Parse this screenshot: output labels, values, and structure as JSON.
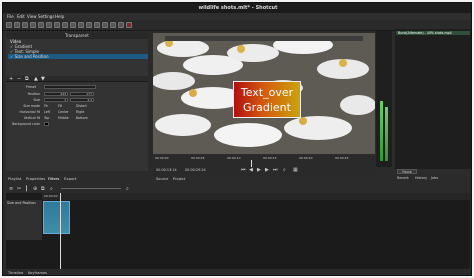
{
  "window": {
    "title": "wildlife shots.mlt* - Shotcut"
  },
  "menu": [
    "File",
    "Edit",
    "View",
    "Settings",
    "Help"
  ],
  "filters": {
    "header": "Transparent",
    "group_label": "Video",
    "items": [
      "Gradient",
      "Text: Simple",
      "Size and Position"
    ],
    "selected_index": 2
  },
  "properties": {
    "preset_label": "Preset",
    "rows": [
      {
        "label": "Position",
        "values": [
          "444",
          "177"
        ]
      },
      {
        "label": "Size",
        "values": [
          "1",
          "4.4"
        ]
      },
      {
        "label": "Size mode",
        "options": [
          "Fit",
          "Fill",
          "Distort"
        ]
      },
      {
        "label": "Horizontal fit",
        "options": [
          "Left",
          "Center",
          "Right"
        ]
      },
      {
        "label": "Vertical fit",
        "options": [
          "Top",
          "Middle",
          "Bottom"
        ]
      },
      {
        "label": "Background color",
        "values": []
      }
    ]
  },
  "lower_tabs": [
    "Playlist",
    "Properties",
    "Filters",
    "Export"
  ],
  "preview": {
    "overlay_line1": "Text_over",
    "overlay_line2": "Gradient",
    "overlay_colors": [
      "#b01010",
      "#d55a10",
      "#c9a40a"
    ]
  },
  "scrubber": {
    "ticks": [
      "00:00:00",
      "00:00:05",
      "00:00:10",
      "00:00:15",
      "00:00:20",
      "00:00:25"
    ],
    "current_time": "00:00:13:14",
    "duration": "00:00:29:24"
  },
  "viewer_tabs": [
    "Source",
    "Project"
  ],
  "playlist": {
    "item": "Burst(Alternate) - 40% shots.mp4"
  },
  "playlist_controls": {
    "pause_label": "Pause",
    "tabs": [
      "Recent",
      "History",
      "Jobs"
    ]
  },
  "timeline": {
    "ruler": [
      "00:00:00"
    ],
    "track_name": "Size and Position"
  },
  "bottom_tabs": [
    "Timeline",
    "Keyframes"
  ]
}
